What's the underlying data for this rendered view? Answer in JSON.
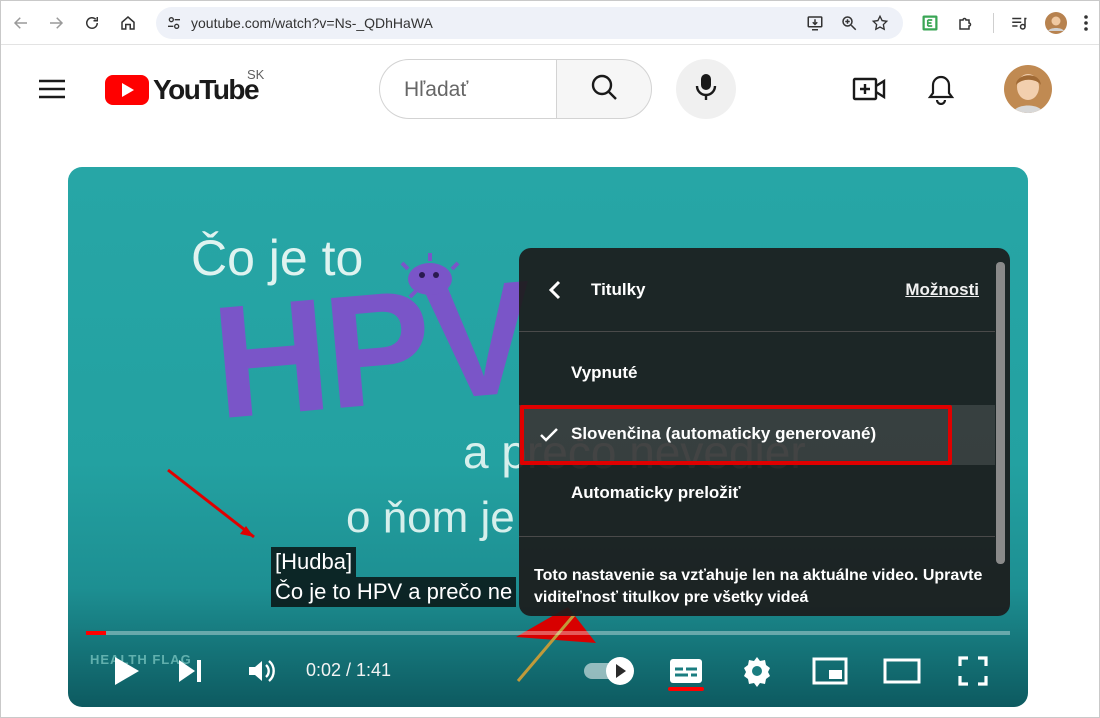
{
  "browser": {
    "url": "youtube.com/watch?v=Ns-_QDhHaWA"
  },
  "youtube": {
    "logo_text": "YouTube",
    "country_code": "SK",
    "search_placeholder": "Hľadať"
  },
  "video": {
    "title_line_1": "Čo je to",
    "title_hpv": "HPV",
    "title_line_2": "a prečo nevedier",
    "title_line_3": "o ňom je",
    "watermark": "HEALTH FLAG",
    "captions": [
      "[Hudba]",
      "Čo je to HPV a prečo ne"
    ],
    "time_display": "0:02 / 1:41",
    "progress_fraction": 0.0022,
    "highlight_color": "#e00000",
    "accent_color": "#ff0000"
  },
  "subtitles_panel": {
    "title": "Titulky",
    "options_link": "Možnosti",
    "items": [
      {
        "label": "Vypnuté",
        "selected": false
      },
      {
        "label": "Slovenčina (automaticky generované)",
        "selected": true
      },
      {
        "label": "Automaticky preložiť",
        "selected": false
      }
    ],
    "note": "Toto nastavenie sa vzťahuje len na aktuálne video. Upravte viditeľnosť titulkov pre všetky videá"
  },
  "icons": {
    "back": "arrow-left-icon",
    "forward": "arrow-right-icon",
    "reload": "reload-icon",
    "home": "home-icon",
    "site_settings": "tune-icon",
    "install": "install-icon",
    "zoom": "zoom-icon",
    "bookmark": "star-icon",
    "extension_e": "extension-e-icon",
    "extensions": "puzzle-icon",
    "media": "media-control-icon",
    "browser_menu": "kebab-menu-icon",
    "hamburger": "hamburger-menu-icon",
    "search": "search-icon",
    "mic": "microphone-icon",
    "create": "create-video-icon",
    "notifications": "bell-icon",
    "play": "play-icon",
    "next": "skip-next-icon",
    "volume": "volume-icon",
    "autoplay": "autoplay-toggle-icon",
    "captions": "subtitles-icon",
    "settings": "gear-icon",
    "miniplayer": "miniplayer-icon",
    "theater": "theater-mode-icon",
    "fullscreen": "fullscreen-icon"
  }
}
